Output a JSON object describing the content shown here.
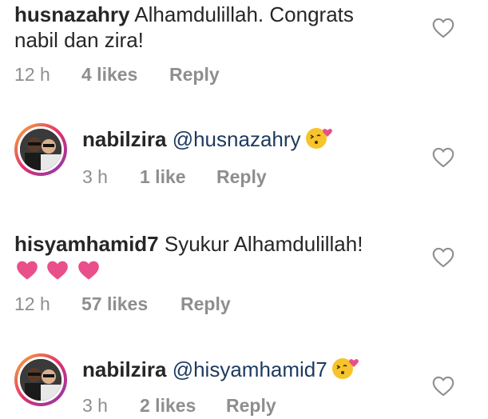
{
  "comments": [
    {
      "username": "husnazahry",
      "text": " Alhamdulillah. Congrats",
      "text_line2": "nabil dan zira!",
      "time": "12 h",
      "likes": "4 likes",
      "reply": "Reply"
    },
    {
      "username": "nabilzira",
      "mention": " @husnazahry",
      "emoji": "kissing-face-emoji",
      "time": "3 h",
      "likes": "1 like",
      "reply": "Reply"
    },
    {
      "username": "hisyamhamid7",
      "text": " Syukur Alhamdulillah!",
      "hearts": [
        "pink-heart",
        "pink-heart",
        "pink-heart"
      ],
      "time": "12 h",
      "likes": "57 likes",
      "reply": "Reply"
    },
    {
      "username": "nabilzira",
      "mention": " @hisyamhamid7",
      "emoji": "kissing-face-emoji",
      "time": "3 h",
      "likes": "2 likes",
      "reply": "Reply"
    }
  ],
  "colors": {
    "text": "#262626",
    "meta": "#8e8e8e",
    "mention": "#1d3a5f",
    "heart_pink": "#e94f8a",
    "emoji_yellow": "#f6c42c"
  },
  "icons": {
    "like": "heart-outline-icon"
  }
}
